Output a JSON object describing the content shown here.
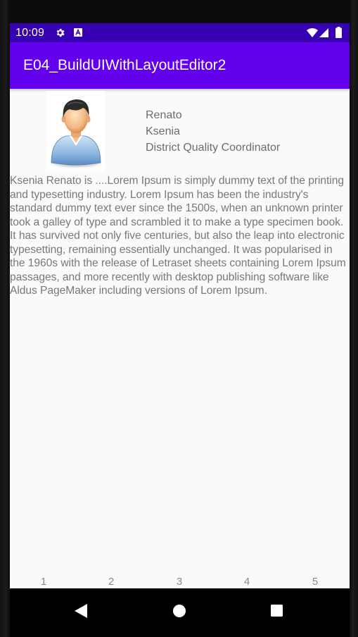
{
  "status_bar": {
    "time": "10:09",
    "icons": [
      "gear-icon",
      "a-notification-icon",
      "wifi-icon",
      "signal-icon",
      "battery-icon"
    ]
  },
  "app_bar": {
    "title": "E04_BuildUIWithLayoutEditor2"
  },
  "profile": {
    "avatar_icon": "person-avatar-icon",
    "first_name": "Renato",
    "last_name": "Ksenia",
    "job_title": "District Quality Coordinator"
  },
  "description": "Ksenia Renato is ....Lorem Ipsum is simply dummy text of the printing and typesetting industry. Lorem Ipsum has been the industry's standard dummy text ever since the 1500s, when an unknown printer took a galley of type and scrambled it to make a type specimen book. It has survived not only five centuries, but also the leap into electronic typesetting, remaining essentially unchanged. It was popularised in the 1960s with the release of Letraset sheets containing Lorem Ipsum passages, and more recently with desktop publishing software like Aldus PageMaker including versions of Lorem Ipsum.",
  "pager": [
    "1",
    "2",
    "3",
    "4",
    "5"
  ],
  "nav_bar": {
    "icons": [
      "back-icon",
      "home-icon",
      "recents-icon"
    ]
  },
  "colors": {
    "status_bar": "#3700b3",
    "app_bar": "#6200ee",
    "background": "#fafafa",
    "text": "#6d6d6d"
  }
}
